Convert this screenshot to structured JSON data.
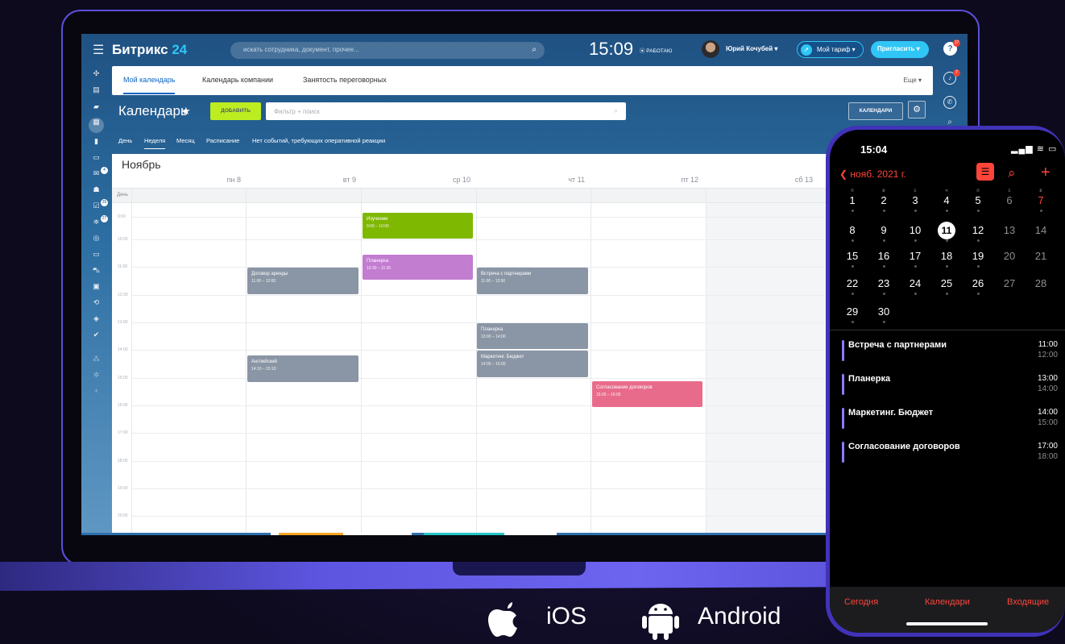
{
  "header": {
    "logo_name": "Битрикс",
    "logo_num": "24",
    "search_placeholder": "искать сотрудника, документ, прочее...",
    "time": "15:09",
    "status": "⦿ РАБОТАЮ",
    "user": "Юрий Кочубей ▾",
    "tariff": "Мой тариф ▾",
    "invite": "Пригласить ▾",
    "help": "?",
    "help_badge": "17",
    "notif_badge": "7"
  },
  "sidebar": {
    "badges": [
      "4",
      "35",
      "27"
    ]
  },
  "tabs": [
    "Мой календарь",
    "Календарь компании",
    "Занятость переговорных"
  ],
  "more": "Еще ▾",
  "page": {
    "title": "Календарь",
    "star": "★",
    "add": "ДОБАВИТЬ",
    "filter_placeholder": "Фильтр + поиск",
    "calendars": "КАЛЕНДАРИ"
  },
  "views": [
    "День",
    "Неделя",
    "Месяц",
    "Расписание",
    "Нет событий, требующих оперативной реакции"
  ],
  "calendar": {
    "month": "Ноябрь",
    "allday": "День",
    "days": [
      "пн 8",
      "вт 9",
      "ср 10",
      "чт 11",
      "пт 12",
      "сб 13"
    ],
    "hours": [
      "9:00",
      "10:00",
      "11:00",
      "12:00",
      "13:00",
      "14:00",
      "15:00",
      "16:00",
      "17:00",
      "18:00",
      "19:00",
      "20:00"
    ],
    "events": [
      {
        "title": "Изучение",
        "time": "9:00 – 10:00",
        "color": "#7fb800"
      },
      {
        "title": "Планерка",
        "time": "10:30 – 11:30",
        "color": "#c27cd0"
      },
      {
        "title": "Договор аренды",
        "time": "11:00 – 12:00",
        "color": "#8a95a5"
      },
      {
        "title": "Встреча с партнерами",
        "time": "11:00 – 12:00",
        "color": "#8a95a5"
      },
      {
        "title": "Планерка",
        "time": "13:00 – 14:00",
        "color": "#8a95a5"
      },
      {
        "title": "Маркетинг. Бюджет",
        "time": "14:00 – 15:00",
        "color": "#8a95a5"
      },
      {
        "title": "Английский",
        "time": "14:10 – 15:10",
        "color": "#8a95a5"
      },
      {
        "title": "Согласование договоров",
        "time": "15:05 – 16:05",
        "color": "#e96b8b"
      }
    ]
  },
  "phone": {
    "time": "15:04",
    "status": "▂▄▆ ≋ ▭",
    "back": "❮ нояб. 2021 г.",
    "weekdays": [
      "п",
      "в",
      "с",
      "ч",
      "п",
      "с",
      "в"
    ],
    "events": [
      {
        "title": "Встреча с партнерами",
        "start": "11:00",
        "end": "12:00"
      },
      {
        "title": "Планерка",
        "start": "13:00",
        "end": "14:00"
      },
      {
        "title": "Маркетинг. Бюджет",
        "start": "14:00",
        "end": "15:00"
      },
      {
        "title": "Согласование договоров",
        "start": "17:00",
        "end": "18:00"
      }
    ],
    "tabs": [
      "Сегодня",
      "Календари",
      "Входящие"
    ]
  },
  "platforms": [
    "iOS",
    "Android"
  ]
}
